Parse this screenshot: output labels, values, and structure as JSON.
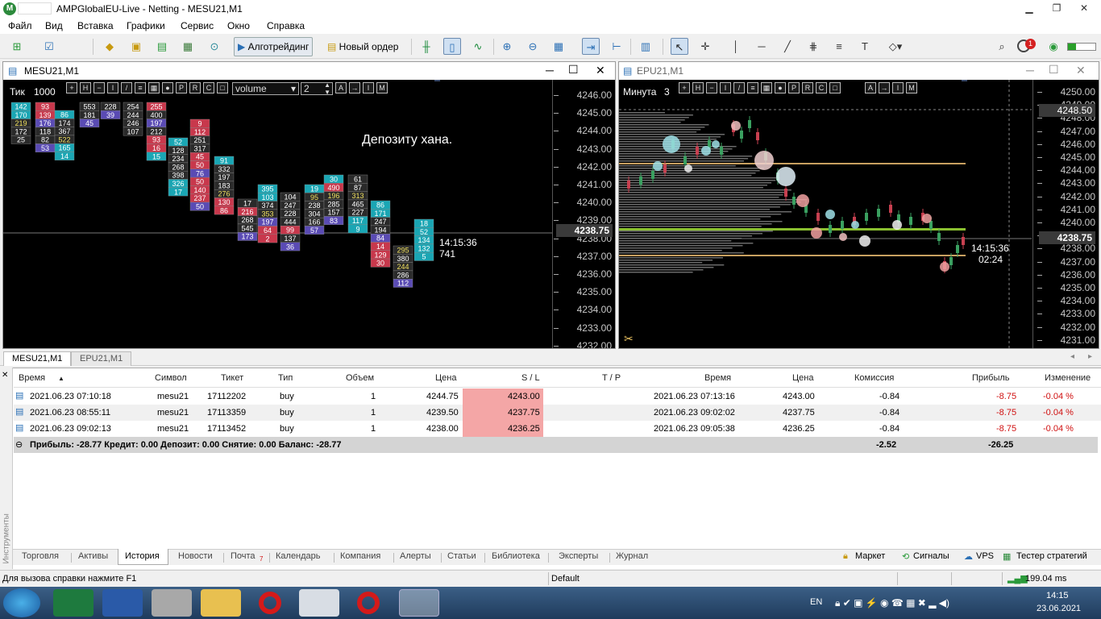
{
  "window": {
    "title": "AMPGlobalEU-Live - Netting - MESU21,M1",
    "minimize": "▁",
    "restore": "❐",
    "close": "✕"
  },
  "menu": [
    "Файл",
    "Вид",
    "Вставка",
    "Графики",
    "Сервис",
    "Окно",
    "Справка"
  ],
  "toolbar": {
    "algotrading": "Алготрейдинг",
    "new_order": "Новый ордер",
    "notif_count": "1"
  },
  "chart_left": {
    "title": "MESU21,M1",
    "mode": "Тик",
    "ticks": "1000",
    "indicator": "volume",
    "value": "2",
    "annotation": "Депозиту хана.",
    "current_price": "4238.75",
    "time_label": "14:15:36",
    "volume_label": "741",
    "prices": [
      "4246.00",
      "4245.00",
      "4244.00",
      "4243.00",
      "4242.00",
      "4241.00",
      "4240.00",
      "4239.00",
      "4238.00",
      "4237.00",
      "4236.00",
      "4235.00",
      "4234.00",
      "4233.00",
      "4232.00"
    ],
    "columns": [
      {
        "c": [
          "142",
          "170",
          "219",
          "172",
          "25"
        ],
        "k": [
          "t",
          "t",
          "y",
          "w",
          "w"
        ]
      },
      {
        "c": [
          "93",
          "139",
          "176",
          "118",
          "82",
          "53"
        ],
        "k": [
          "r",
          "r",
          "p",
          "w",
          "w",
          "p"
        ]
      },
      {
        "c": [
          "86",
          "174",
          "367",
          "522",
          "165",
          "14"
        ],
        "k": [
          "t",
          "w",
          "w",
          "y",
          "t",
          "t"
        ]
      },
      {
        "c": [
          "553",
          "181",
          "45"
        ],
        "k": [
          "w",
          "w",
          "p"
        ]
      },
      {
        "c": [
          "228",
          "39"
        ],
        "k": [
          "w",
          "p"
        ]
      },
      {
        "c": [
          "254",
          "244",
          "246",
          "107"
        ],
        "k": [
          "w",
          "w",
          "w",
          "w"
        ]
      },
      {
        "c": [
          "255",
          "400",
          "197",
          "212",
          "93",
          "16",
          "15"
        ],
        "k": [
          "r",
          "w",
          "p",
          "w",
          "r",
          "r",
          "t"
        ]
      },
      {
        "c": [
          "52",
          "128",
          "234",
          "268",
          "398",
          "326",
          "17"
        ],
        "k": [
          "t",
          "w",
          "w",
          "w",
          "w",
          "t",
          "t"
        ]
      },
      {
        "c": [
          "9",
          "112",
          "251",
          "317",
          "45",
          "50",
          "76",
          "50",
          "140",
          "237",
          "50"
        ],
        "k": [
          "r",
          "r",
          "w",
          "w",
          "r",
          "r",
          "p",
          "r",
          "r",
          "r",
          "p"
        ]
      },
      {
        "c": [
          "91",
          "332",
          "197",
          "183",
          "276",
          "130",
          "86"
        ],
        "k": [
          "t",
          "w",
          "w",
          "w",
          "y",
          "r",
          "r"
        ]
      },
      {
        "c": [
          "17",
          "216",
          "268",
          "545",
          "173"
        ],
        "k": [
          "w",
          "r",
          "w",
          "w",
          "p"
        ]
      },
      {
        "c": [
          "395",
          "103",
          "374",
          "353",
          "197",
          "64",
          "2"
        ],
        "k": [
          "t",
          "t",
          "w",
          "y",
          "p",
          "r",
          "r"
        ]
      },
      {
        "c": [
          "104",
          "247",
          "228",
          "444",
          "99",
          "137",
          "36"
        ],
        "k": [
          "w",
          "w",
          "w",
          "w",
          "r",
          "w",
          "p"
        ]
      },
      {
        "c": [
          "19",
          "95",
          "238",
          "304",
          "166",
          "57"
        ],
        "k": [
          "t",
          "y",
          "w",
          "w",
          "w",
          "p"
        ]
      },
      {
        "c": [
          "30",
          "490",
          "196",
          "285",
          "157",
          "83"
        ],
        "k": [
          "t",
          "r",
          "y",
          "w",
          "w",
          "p"
        ]
      },
      {
        "c": [
          "61",
          "87",
          "313",
          "465",
          "227",
          "117",
          "9"
        ],
        "k": [
          "w",
          "w",
          "y",
          "w",
          "w",
          "t",
          "t"
        ]
      },
      {
        "c": [
          "86",
          "171",
          "247",
          "194",
          "84",
          "14",
          "129",
          "30"
        ],
        "k": [
          "t",
          "t",
          "w",
          "w",
          "p",
          "r",
          "r",
          "r"
        ]
      },
      {
        "c": [
          "295",
          "380",
          "244",
          "286",
          "112"
        ],
        "k": [
          "y",
          "w",
          "y",
          "w",
          "p"
        ]
      },
      {
        "c": [
          "18",
          "52",
          "134",
          "132",
          "5"
        ],
        "k": [
          "t",
          "t",
          "t",
          "t",
          "t"
        ]
      }
    ]
  },
  "chart_right": {
    "title": "EPU21,M1",
    "mode": "Минута",
    "value": "3",
    "current_price": "4238.75",
    "high_label": "4248.50",
    "time_label": "14:15:36",
    "countdown": "02:24",
    "prices": [
      "4250.00",
      "4249.00",
      "4248.00",
      "4247.00",
      "4246.00",
      "4245.00",
      "4244.00",
      "4243.00",
      "4242.00",
      "4241.00",
      "4240.00",
      "4239.00",
      "4238.00",
      "4237.00",
      "4236.00",
      "4235.00",
      "4234.00",
      "4233.00",
      "4232.00",
      "4231.00"
    ]
  },
  "chart_tabs": [
    "MESU21,M1",
    "EPU21,M1"
  ],
  "history": {
    "headers": [
      "Время",
      "Символ",
      "Тикет",
      "Тип",
      "Объем",
      "Цена",
      "S / L",
      "T / P",
      "Время",
      "Цена",
      "Комиссия",
      "Прибыль",
      "Изменение"
    ],
    "rows": [
      {
        "time": "2021.06.23 07:10:18",
        "symbol": "mesu21",
        "ticket": "17112202",
        "type": "buy",
        "volume": "1",
        "price": "4244.75",
        "sl": "4243.00",
        "tp": "",
        "close_time": "2021.06.23 07:13:16",
        "close_price": "4243.00",
        "commission": "-0.84",
        "profit": "-8.75",
        "change": "-0.04 %"
      },
      {
        "time": "2021.06.23 08:55:11",
        "symbol": "mesu21",
        "ticket": "17113359",
        "type": "buy",
        "volume": "1",
        "price": "4239.50",
        "sl": "4237.75",
        "tp": "",
        "close_time": "2021.06.23 09:02:02",
        "close_price": "4237.75",
        "commission": "-0.84",
        "profit": "-8.75",
        "change": "-0.04 %"
      },
      {
        "time": "2021.06.23 09:02:13",
        "symbol": "mesu21",
        "ticket": "17113452",
        "type": "buy",
        "volume": "1",
        "price": "4238.00",
        "sl": "4236.25",
        "tp": "",
        "close_time": "2021.06.23 09:05:38",
        "close_price": "4236.25",
        "commission": "-0.84",
        "profit": "-8.75",
        "change": "-0.04 %"
      }
    ],
    "summary": "Прибыль: -28.77  Кредит: 0.00  Депозит: 0.00  Снятие: 0.00  Баланс: -28.77",
    "summary_commission": "-2.52",
    "summary_profit": "-26.25"
  },
  "side_label": "Инструменты",
  "bottom_tabs": [
    "Торговля",
    "Активы",
    "История",
    "Новости",
    "Почта",
    "Календарь",
    "Компания",
    "Алерты",
    "Статьи",
    "Библиотека",
    "Эксперты",
    "Журнал"
  ],
  "mail_count": "7",
  "right_tabs": [
    "Маркет",
    "Сигналы",
    "VPS",
    "Тестер стратегий"
  ],
  "status": {
    "help": "Для вызова справки нажмите F1",
    "profile": "Default",
    "ping": "199.04 ms"
  },
  "taskbar": {
    "lang": "EN",
    "time": "14:15",
    "date": "23.06.2021"
  },
  "colors": {
    "cell_t": "#1aa6b4",
    "cell_r": "#c8384c",
    "cell_p": "#5a4bb4",
    "cell_w": "#2a2a2a",
    "cell_y": "#2a2a2a",
    "sl": "#f4a6a6",
    "profit": "#d01010"
  }
}
